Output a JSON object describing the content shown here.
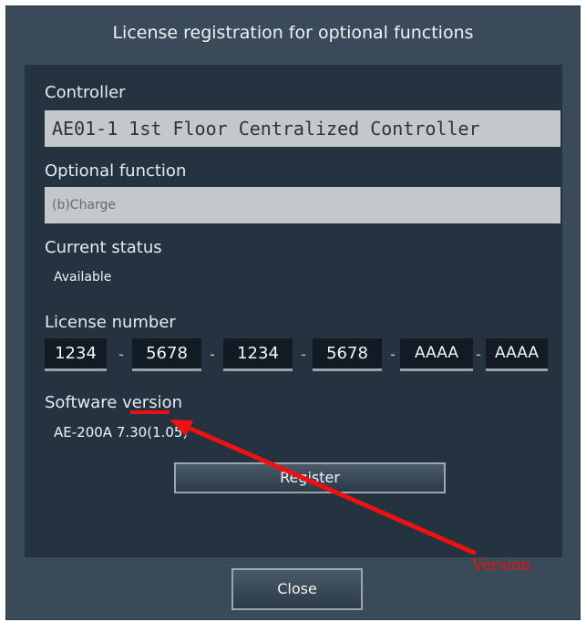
{
  "dialog": {
    "title": "License registration for optional functions",
    "controller_label": "Controller",
    "controller_value": "AE01-1 1st Floor Centralized Controller",
    "optional_function_label": "Optional function",
    "optional_function_value": "(b)Charge",
    "current_status_label": "Current status",
    "current_status_value": "Available",
    "license_number_label": "License number",
    "license_number_parts": [
      "1234",
      "5678",
      "1234",
      "5678",
      "AAAA",
      "AAAA"
    ],
    "license_separator": "-",
    "software_version_label": "Software version",
    "software_version_prefix": "AE-200A ",
    "software_version_number": "7.30",
    "software_version_suffix": "(1.05)",
    "register_button": "Register",
    "close_button": "Close"
  },
  "annotation": {
    "text": "Version",
    "color": "#ee1111"
  }
}
